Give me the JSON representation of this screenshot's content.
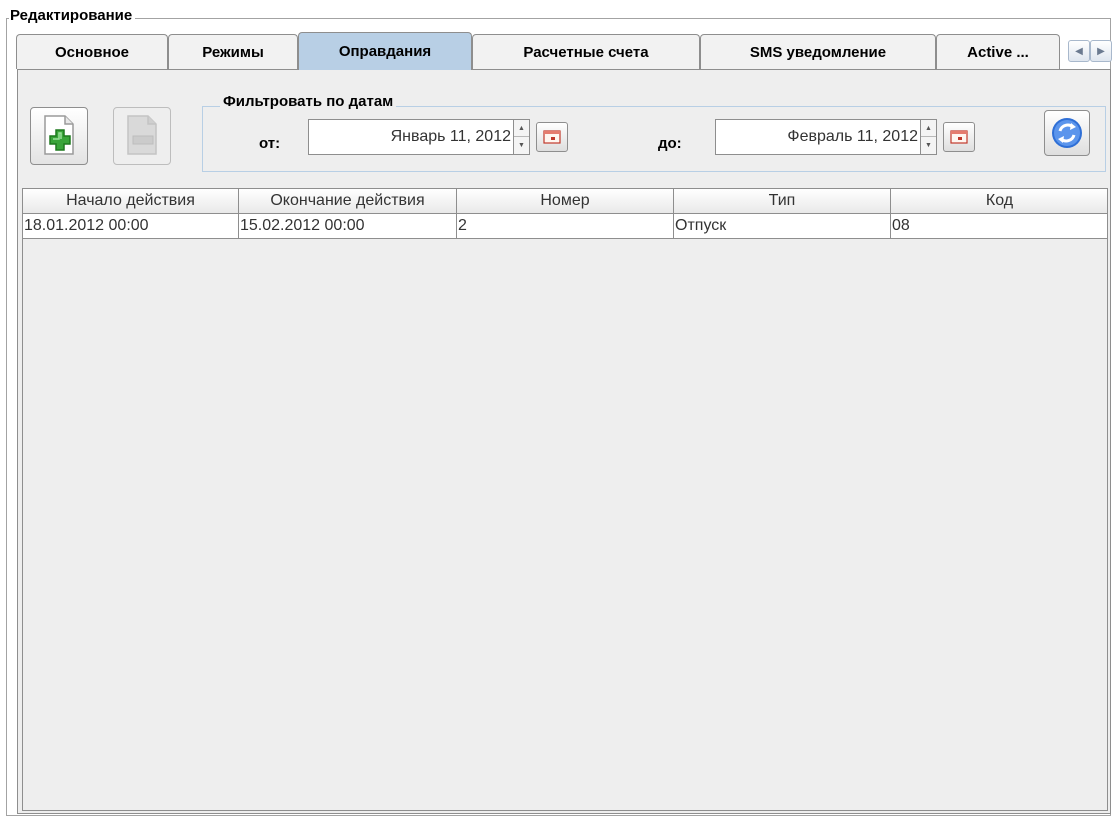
{
  "editing_title": "Редактирование",
  "tabs": [
    {
      "label": "Основное",
      "selected": false
    },
    {
      "label": "Режимы",
      "selected": false
    },
    {
      "label": "Оправдания",
      "selected": true
    },
    {
      "label": "Расчетные счета",
      "selected": false
    },
    {
      "label": "SMS уведомление",
      "selected": false
    },
    {
      "label": "Active ...",
      "selected": false
    }
  ],
  "tab_scroll": {
    "left_icon": "arrow-left-icon",
    "right_icon": "arrow-right-icon"
  },
  "toolbar": {
    "add_icon": "document-add-icon",
    "remove_icon": "document-remove-icon",
    "refresh_icon": "refresh-icon"
  },
  "filter": {
    "title": "Фильтровать по датам",
    "from_label": "от:",
    "from_value": "Январь 11, 2012",
    "to_label": "до:",
    "to_value": "Февраль 11, 2012",
    "calendar_icon": "calendar-icon"
  },
  "table": {
    "columns": [
      "Начало действия",
      "Окончание действия",
      "Номер",
      "Тип",
      "Код"
    ],
    "rows": [
      [
        "18.01.2012 00:00",
        "15.02.2012 00:00",
        "2",
        "Отпуск",
        "08"
      ]
    ]
  },
  "colors": {
    "selected_tab": "#b8cfe5",
    "panel_background": "#eeeeee",
    "border": "#8e8e8e",
    "add_icon_green": "#3aa53a",
    "refresh_icon_blue": "#2f6fd6"
  }
}
